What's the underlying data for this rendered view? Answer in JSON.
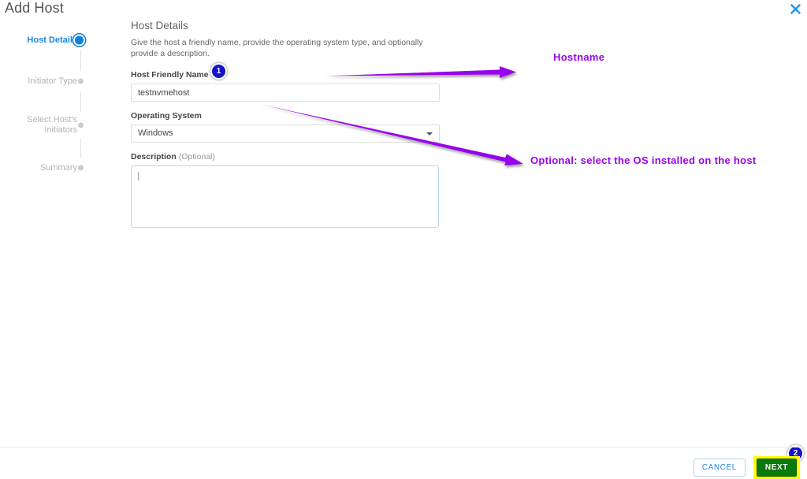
{
  "window": {
    "title": "Add Host",
    "close_icon": "close-icon"
  },
  "stepper": {
    "steps": [
      {
        "label": "Host Details",
        "active": true
      },
      {
        "label": "Initiator Type",
        "active": false
      },
      {
        "label": "Select Host's\nInitiators",
        "active": false
      },
      {
        "label": "Summary",
        "active": false
      }
    ]
  },
  "form": {
    "heading": "Host Details",
    "description": "Give the host a friendly name, provide the operating system type, and optionally provide a description.",
    "host_name": {
      "label": "Host Friendly Name",
      "value": "testnvmehost",
      "placeholder": ""
    },
    "operating_system": {
      "label": "Operating System",
      "value": "Windows",
      "caret_icon": "chevron-down-icon"
    },
    "description_field": {
      "label": "Description",
      "optional_suffix": "(Optional)",
      "value": "",
      "placeholder": ""
    }
  },
  "annotations": {
    "accent_color": "#9900ee",
    "hostname_note": "Hostname",
    "os_note": "Optional: select the OS installed on the host",
    "badges": [
      {
        "number": "1"
      },
      {
        "number": "2"
      }
    ]
  },
  "footer": {
    "cancel_label": "CANCEL",
    "next_label": "NEXT",
    "next_highlight_color": "#ffff00",
    "next_button_color": "#0a7a0a"
  }
}
